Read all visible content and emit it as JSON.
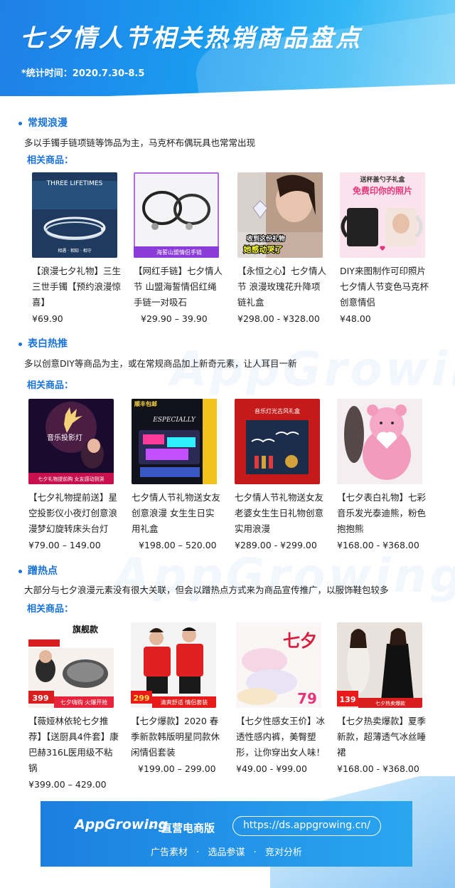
{
  "header": {
    "title": "七夕情人节相关热销商品盘点",
    "date": "*统计时间：2020.7.30-8.5"
  },
  "watermark": "AppGrowing",
  "sections": [
    {
      "title": "常规浪漫",
      "desc": "多以手镯手链项链等饰品为主，马克杯布偶玩具也常常出现",
      "sub": "相关商品：",
      "products": [
        {
          "title": "【浪漫七夕礼物】三生三世手镯【预约浪漫惊喜】",
          "price": "¥69.90",
          "img_text": "THREE LIFETIMES",
          "img_sub": "相遇 · 相知 · 相守"
        },
        {
          "title": "【网红手链】七夕情人节 山盟海誓情侣红绳手链一对吸石",
          "price": "¥29.90 – 39.90",
          "img_text": "海誓山盟情侣手链"
        },
        {
          "title": "【永恒之心】七夕情人节 浪漫玫瑰花升降项链礼盒",
          "price": "¥298.00 - ¥328.00",
          "img_text": "收到这份礼物",
          "img_sub": "她感动哭了"
        },
        {
          "title": "DIY来图制作可印照片七夕情人节变色马克杯创意情侣",
          "price": "¥48.00",
          "img_text": "送杯盖勺子礼盒",
          "img_sub": "免费印你的照片"
        }
      ]
    },
    {
      "title": "表白热推",
      "desc": "多以创意DIY等商品为主，或在常规商品加上新奇元素，让人耳目一新",
      "sub": "相关商品：",
      "products": [
        {
          "title": "【七夕礼物提前送】星空投影仪小夜灯创意浪漫梦幻旋转床头台灯",
          "price": "¥79.00 – 149.00",
          "img_text": "音乐投影灯",
          "img_sub": "七夕礼物提前购 女友感动到哭"
        },
        {
          "title": "七夕情人节礼物送女友创意浪漫 女生生日实用礼盒",
          "price": "¥198.00 – 520.00",
          "img_text": "顺丰包邮",
          "img_sub": "ESPECIALLY"
        },
        {
          "title": "七夕情人节礼物送女友老婆女生生日礼物创意实用浪漫",
          "price": "¥289.00 - ¥299.00",
          "img_text": "音乐灯光古风礼盒"
        },
        {
          "title": "【七夕表白礼物】七彩音乐发光泰迪熊，粉色抱抱熊",
          "price": "¥168.00 - ¥368.00",
          "img_text": ""
        }
      ]
    },
    {
      "title": "蹭热点",
      "desc": "大部分与七夕浪漫元素没有很大关联，但会以蹭热点方式来为商品宣传推广，以服饰鞋包较多",
      "sub": "相关商品：",
      "products": [
        {
          "title": "【薇娅林依轮七夕推荐】【送厨具4件套】康巴赫316L医用级不粘锅",
          "price": "¥399.00 – 429.00",
          "img_text": "旗舰款",
          "img_sub": "七夕嗨购 火爆开抢",
          "img_num": "399"
        },
        {
          "title": "【七夕爆款】2020 春季新款韩版明星同款休闲情侣套装",
          "price": "¥199.00 – 299.00",
          "img_text": "清爽舒适 情侣套装",
          "img_num": "299"
        },
        {
          "title": "【七夕性感女王价】冰透性感内裤，美臀塑形，让你穿出女人味！",
          "price": "¥49.00 - ¥99.00",
          "img_text": "七夕",
          "img_num": "79"
        },
        {
          "title": "【七夕热卖爆款】夏季新款，超薄透气冰丝睡裙",
          "price": "¥168.00 - ¥368.00",
          "img_text": "七夕热卖爆款",
          "img_num": "139"
        }
      ]
    }
  ],
  "footer": {
    "logo": "AppGrowing",
    "dash": "–",
    "edition": "直营电商版",
    "url": "https://ds.appgrowing.cn/",
    "tags": [
      "广告素材",
      "·",
      "选品参谋",
      "·",
      "竞对分析"
    ]
  }
}
